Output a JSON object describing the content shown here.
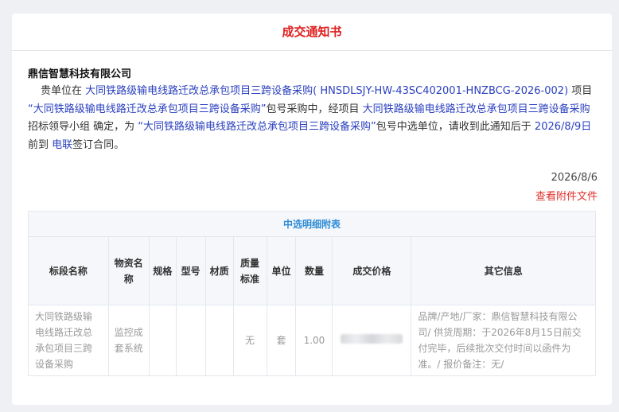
{
  "notice": {
    "title": "成交通知书",
    "company": "鼎信智慧科技有限公司",
    "p1": "贵单位在",
    "project_name": "大同铁路级输电线路迁改总承包项目三跨设备采购",
    "project_code": "( HNSDLSJY-HW-43SC402001-HNZBCG-2026-002)",
    "p2": "项目",
    "package_quoted": "“大同铁路级输电线路迁改总承包项目三跨设备采购”",
    "p3": "包号采购中，经项目",
    "project_name_2": "大同铁路级输电线路迁改总承包项目三跨设备采购",
    "p4": "招标领导小组 确定，为",
    "package_quoted_2": "“大同铁路级输电线路迁改总承包项目三跨设备采购”",
    "p5": "包号中选单位，请收到此通知后于",
    "deadline": "2026/8/9日",
    "p6": "前到",
    "location": "电联",
    "p7": "签订合同。",
    "date": "2026/8/6",
    "attachment_link": "查看附件文件"
  },
  "detail_table": {
    "title": "中选明细附表",
    "headers": [
      "标段名称",
      "物资名称",
      "规格",
      "型号",
      "材质",
      "质量标准",
      "单位",
      "数量",
      "成交价格",
      "其它信息"
    ],
    "rows": [
      {
        "section": "大同铁路级输电线路迁改总承包项目三跨设备采购",
        "material": "监控成套系统",
        "spec": "",
        "model": "",
        "texture": "",
        "quality": "无",
        "unit": "套",
        "quantity": "1.00",
        "price": "",
        "other": "品牌/产地/厂家：鼎信智慧科技有限公司/ 供货周期：于2026年8月15日前交付完毕，后续批次交付时间以函件为准。/ 报价备注：无/"
      }
    ]
  },
  "colors": {
    "title_red": "#e02020",
    "link_blue": "#2a3fbf",
    "table_title_blue": "#2f8cd6",
    "attachment_red": "#e0302b"
  }
}
